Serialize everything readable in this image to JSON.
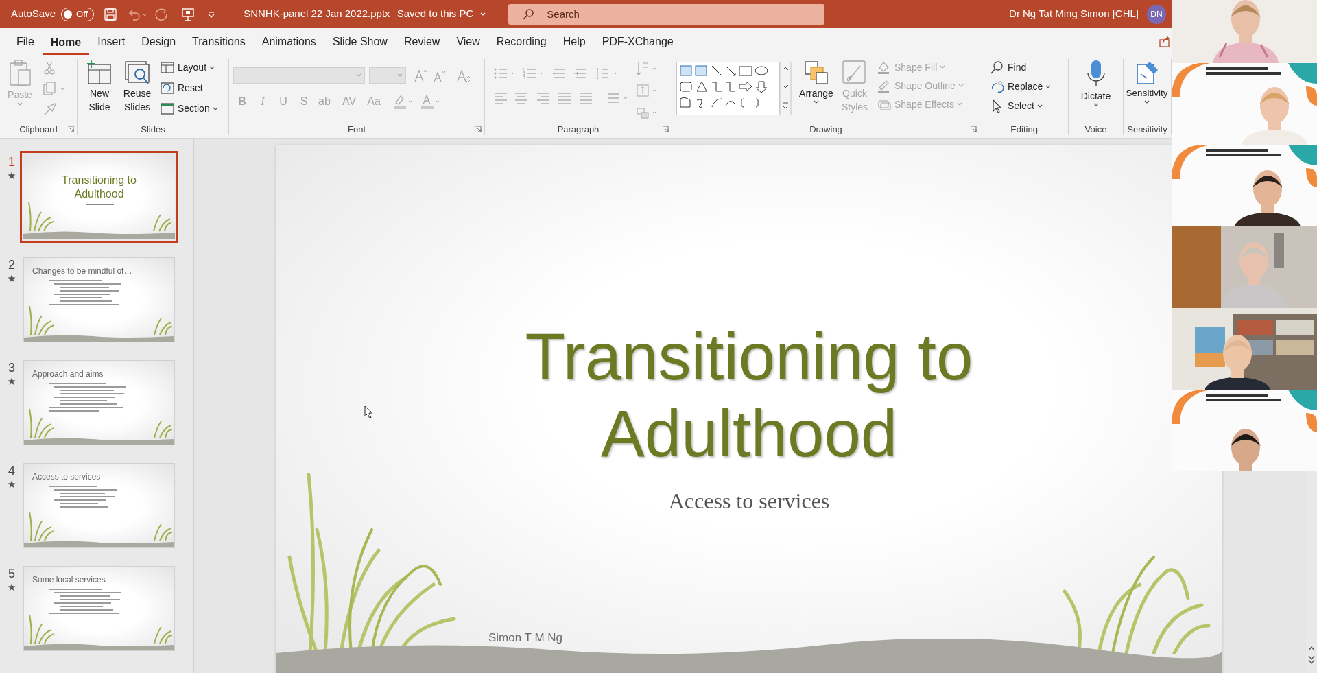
{
  "title_bar": {
    "autosave_label": "AutoSave",
    "autosave_toggle": {
      "label": "Off",
      "on": false
    },
    "document_title": "SNNHK-panel 22 Jan 2022.pptx",
    "save_status": "Saved to this PC",
    "search": {
      "placeholder": "Search"
    },
    "user_name": "Dr Ng Tat Ming Simon [CHL]",
    "user_initials": "DN"
  },
  "tabs": [
    {
      "label": "File",
      "selected": false
    },
    {
      "label": "Home",
      "selected": true
    },
    {
      "label": "Insert",
      "selected": false
    },
    {
      "label": "Design",
      "selected": false
    },
    {
      "label": "Transitions",
      "selected": false
    },
    {
      "label": "Animations",
      "selected": false
    },
    {
      "label": "Slide Show",
      "selected": false
    },
    {
      "label": "Review",
      "selected": false
    },
    {
      "label": "View",
      "selected": false
    },
    {
      "label": "Recording",
      "selected": false
    },
    {
      "label": "Help",
      "selected": false
    },
    {
      "label": "PDF-XChange",
      "selected": false
    }
  ],
  "ribbon": {
    "clipboard": {
      "label": "Clipboard",
      "paste": {
        "label": "Paste",
        "disabled": true
      }
    },
    "slides": {
      "label": "Slides",
      "new_slide": "New Slide",
      "reuse_slides": "Reuse Slides",
      "layout": "Layout",
      "reset": "Reset",
      "section": "Section"
    },
    "font": {
      "label": "Font",
      "disabled": true,
      "format_buttons": [
        "B",
        "I",
        "U",
        "S",
        "ab",
        "AV",
        "Aa"
      ]
    },
    "paragraph": {
      "label": "Paragraph"
    },
    "drawing": {
      "label": "Drawing",
      "arrange": "Arrange",
      "quick_styles": {
        "label": "Quick Styles",
        "disabled": true
      },
      "shape_options": [
        {
          "label": "Shape Fill",
          "disabled": true
        },
        {
          "label": "Shape Outline",
          "disabled": true
        },
        {
          "label": "Shape Effects",
          "disabled": true
        }
      ]
    },
    "editing": {
      "label": "Editing",
      "find": "Find",
      "replace": "Replace",
      "select": "Select"
    },
    "voice": {
      "label": "Voice",
      "dictate": "Dictate"
    },
    "sensitivity": {
      "label": "Sensitivity",
      "button": "Sensitivity"
    }
  },
  "thumbnails": [
    {
      "number": "1",
      "kind": "title",
      "title": "Transitioning to Adulthood",
      "selected": true,
      "has_transition": true
    },
    {
      "number": "2",
      "kind": "content",
      "title": "Changes to be mindful of…",
      "selected": false,
      "has_transition": true
    },
    {
      "number": "3",
      "kind": "content",
      "title": "Approach and aims",
      "selected": false,
      "has_transition": true
    },
    {
      "number": "4",
      "kind": "content",
      "title": "Access to services",
      "selected": false,
      "has_transition": true
    },
    {
      "number": "5",
      "kind": "content",
      "title": "Some local services",
      "selected": false,
      "has_transition": true
    }
  ],
  "slide": {
    "title": "Transitioning to Adulthood",
    "subtitle": "Access to services",
    "author": "Simon T M Ng"
  }
}
